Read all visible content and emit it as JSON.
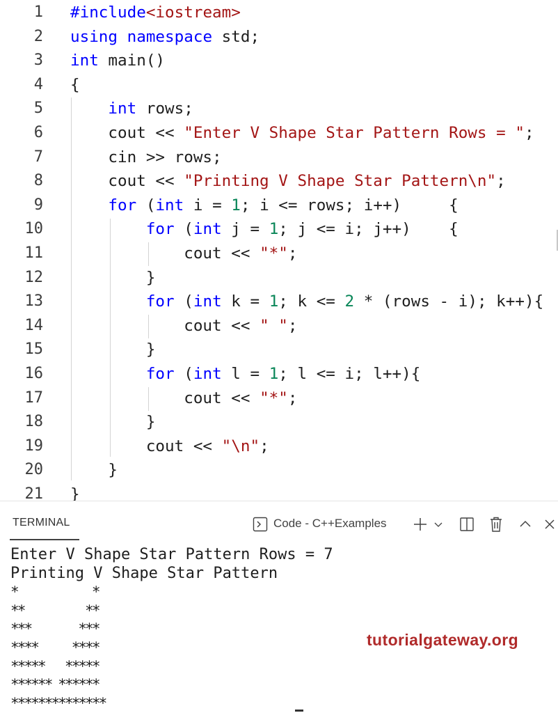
{
  "editor": {
    "lines": [
      {
        "n": "1",
        "tokens": [
          {
            "t": "#include",
            "c": "kw"
          },
          {
            "t": "<iostream>",
            "c": "str"
          }
        ]
      },
      {
        "n": "2",
        "tokens": [
          {
            "t": "using",
            "c": "kw"
          },
          {
            "t": " "
          },
          {
            "t": "namespace",
            "c": "kw"
          },
          {
            "t": " std;"
          }
        ]
      },
      {
        "n": "3",
        "tokens": [
          {
            "t": "int",
            "c": "kw"
          },
          {
            "t": " main()"
          }
        ]
      },
      {
        "n": "4",
        "tokens": [
          {
            "t": "{"
          }
        ]
      },
      {
        "n": "5",
        "tokens": [
          {
            "t": "    "
          },
          {
            "t": "int",
            "c": "kw"
          },
          {
            "t": " rows;"
          }
        ]
      },
      {
        "n": "6",
        "tokens": [
          {
            "t": "    cout << "
          },
          {
            "t": "\"Enter V Shape Star Pattern Rows = \"",
            "c": "str"
          },
          {
            "t": ";"
          }
        ]
      },
      {
        "n": "7",
        "tokens": [
          {
            "t": "    cin >> rows;"
          }
        ]
      },
      {
        "n": "8",
        "tokens": [
          {
            "t": "    cout << "
          },
          {
            "t": "\"Printing V Shape Star Pattern\\n\"",
            "c": "str"
          },
          {
            "t": ";"
          }
        ]
      },
      {
        "n": "9",
        "tokens": [
          {
            "t": "    "
          },
          {
            "t": "for",
            "c": "kw"
          },
          {
            "t": " ("
          },
          {
            "t": "int",
            "c": "kw"
          },
          {
            "t": " i = "
          },
          {
            "t": "1",
            "c": "num"
          },
          {
            "t": "; i <= rows; i++)     {"
          }
        ]
      },
      {
        "n": "10",
        "tokens": [
          {
            "t": "        "
          },
          {
            "t": "for",
            "c": "kw"
          },
          {
            "t": " ("
          },
          {
            "t": "int",
            "c": "kw"
          },
          {
            "t": " j = "
          },
          {
            "t": "1",
            "c": "num"
          },
          {
            "t": "; j <= i; j++)    {"
          }
        ]
      },
      {
        "n": "11",
        "tokens": [
          {
            "t": "            cout << "
          },
          {
            "t": "\"*\"",
            "c": "str"
          },
          {
            "t": ";"
          }
        ]
      },
      {
        "n": "12",
        "tokens": [
          {
            "t": "        }"
          }
        ]
      },
      {
        "n": "13",
        "tokens": [
          {
            "t": "        "
          },
          {
            "t": "for",
            "c": "kw"
          },
          {
            "t": " ("
          },
          {
            "t": "int",
            "c": "kw"
          },
          {
            "t": " k = "
          },
          {
            "t": "1",
            "c": "num"
          },
          {
            "t": "; k <= "
          },
          {
            "t": "2",
            "c": "num"
          },
          {
            "t": " * (rows - i); k++){"
          }
        ]
      },
      {
        "n": "14",
        "tokens": [
          {
            "t": "            cout << "
          },
          {
            "t": "\" \"",
            "c": "str"
          },
          {
            "t": ";"
          }
        ]
      },
      {
        "n": "15",
        "tokens": [
          {
            "t": "        }"
          }
        ]
      },
      {
        "n": "16",
        "tokens": [
          {
            "t": "        "
          },
          {
            "t": "for",
            "c": "kw"
          },
          {
            "t": " ("
          },
          {
            "t": "int",
            "c": "kw"
          },
          {
            "t": " l = "
          },
          {
            "t": "1",
            "c": "num"
          },
          {
            "t": "; l <= i; l++){"
          }
        ]
      },
      {
        "n": "17",
        "tokens": [
          {
            "t": "            cout << "
          },
          {
            "t": "\"*\"",
            "c": "str"
          },
          {
            "t": ";"
          }
        ]
      },
      {
        "n": "18",
        "tokens": [
          {
            "t": "        }"
          }
        ]
      },
      {
        "n": "19",
        "tokens": [
          {
            "t": "        cout << "
          },
          {
            "t": "\"\\n\"",
            "c": "str"
          },
          {
            "t": ";"
          }
        ]
      },
      {
        "n": "20",
        "tokens": [
          {
            "t": "    }"
          }
        ]
      },
      {
        "n": "21",
        "tokens": [
          {
            "t": "}"
          }
        ]
      }
    ]
  },
  "panel": {
    "tab_label": "TERMINAL",
    "terminal_name": "Code - C++Examples",
    "icons": [
      "terminal-icon",
      "add-icon",
      "chevron-down-icon",
      "split-icon",
      "trash-icon",
      "chevron-up-icon",
      "close-icon"
    ],
    "output": [
      "Enter V Shape Star Pattern Rows = 7",
      "Printing V Shape Star Pattern",
      "*           *",
      "**         **",
      "***       ***",
      "****     ****",
      "*****   *****",
      "****** ******",
      "**************"
    ]
  },
  "watermark": "tutorialgateway.org",
  "colors": {
    "keyword": "#0000ff",
    "string": "#a31515",
    "number": "#098658",
    "watermark": "#b02a2a"
  }
}
